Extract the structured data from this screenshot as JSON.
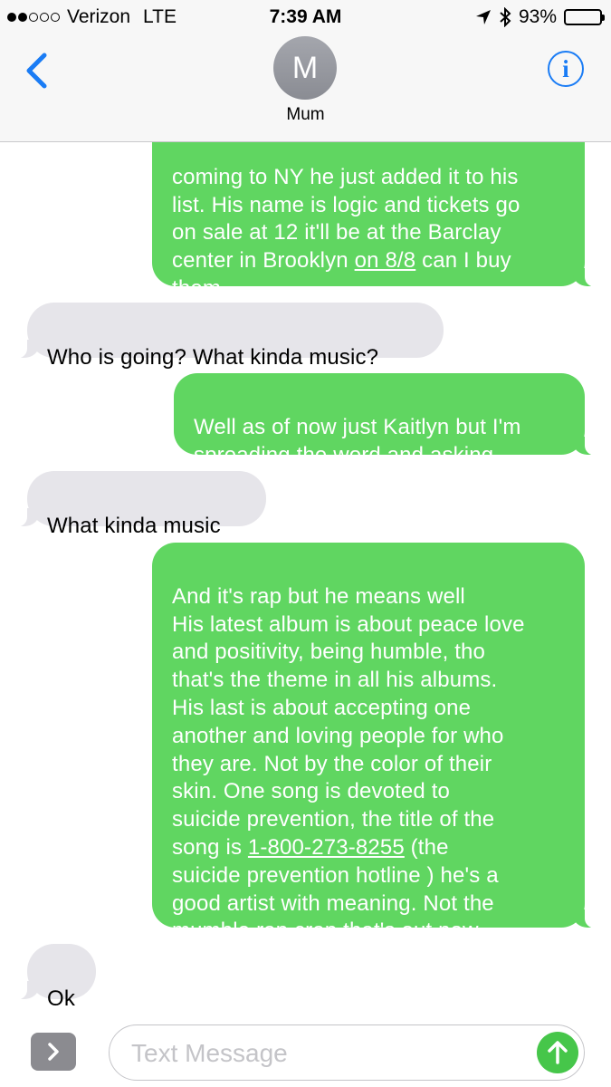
{
  "status_bar": {
    "carrier": "Verizon",
    "network": "LTE",
    "time": "7:39 AM",
    "battery_percent": "93%",
    "battery_level": 0.93,
    "signal_bars_filled": 2,
    "signal_bars_total": 5
  },
  "header": {
    "avatar_initial": "M",
    "contact_name": "Mum",
    "back_icon": "chevron-left-icon",
    "info_icon": "info-icon",
    "accent_color": "#1a7cf5"
  },
  "messages": [
    {
      "from": "me",
      "lines": [
        "coming to NY he just added it to his",
        "list. His name is logic and tickets go",
        "on sale at 12 it'll be at the Barclay"
      ],
      "line4_pre": "center in Brooklyn ",
      "line4_link": "on 8/8",
      "line4_post": " can I buy",
      "line5": "them"
    },
    {
      "from": "contact",
      "text": "Who is going?  What kinda music?"
    },
    {
      "from": "me",
      "text": "Well as of now just Kaitlyn but I'm\nspreading the word and asking"
    },
    {
      "from": "contact",
      "text": "What kinda music"
    },
    {
      "from": "me",
      "text_before_link": "And it's rap but he means well\nHis latest album is about peace love\nand positivity, being humble, tho\nthat's the theme in all his albums.\nHis last is about accepting one\nanother and loving people for who\nthey are. Not by the color of their\nskin. One song is devoted to\nsuicide prevention, the title of the\nsong is ",
      "link": "1-800-273-8255",
      "text_after_link": " (the\nsuicide prevention hotline ) he's a\ngood artist with meaning. Not the\nmumble rap crap that's out now"
    },
    {
      "from": "contact",
      "text": "Ok"
    }
  ],
  "input": {
    "placeholder": "Text Message",
    "value": "",
    "expand_icon": "chevron-right-icon",
    "send_icon": "arrow-up-icon"
  },
  "colors": {
    "sent_bubble": "#60d661",
    "received_bubble": "#e6e5ea",
    "send_button": "#46c64a"
  }
}
